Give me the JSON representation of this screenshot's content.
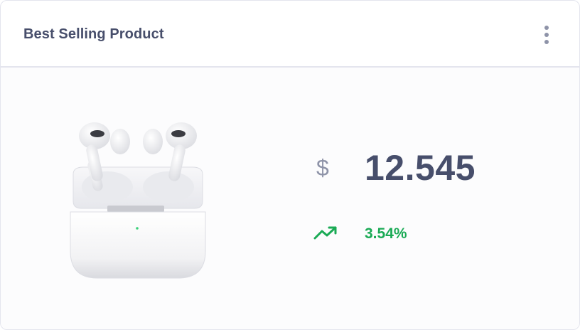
{
  "card": {
    "title": "Best Selling Product",
    "menu_icon": "more-vertical-icon",
    "product_image_icon": "airpods-pro-image",
    "currency_symbol": "$",
    "price": "12.545",
    "trend_icon": "trending-up-icon",
    "trend_percent": "3.54%"
  },
  "colors": {
    "title": "#474e6b",
    "price": "#474e6b",
    "currency": "#8e93a8",
    "trend": "#1aaa55",
    "border": "#e4e5ee"
  }
}
